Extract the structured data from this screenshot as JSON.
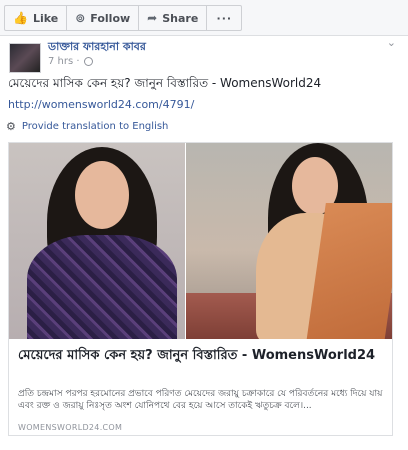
{
  "toolbar": {
    "like_label": "Like",
    "follow_label": "Follow",
    "share_label": "Share",
    "more_label": "···"
  },
  "post": {
    "author": "ডাক্তার ফারহানা কাবর",
    "time": "7 hrs",
    "privacy_icon": "globe-icon",
    "text": "মেয়েদের মাসিক কেন হয়? জানুন বিস্তারিত - WomensWorld24",
    "link": "http://womensworld24.com/4791/",
    "translate_label": "Provide translation to English"
  },
  "card": {
    "title": "মেয়েদের মাসিক কেন হয়? জানুন বিস্তারিত - WomensWorld24",
    "description": "প্রতি চন্দ্রমাস পরপর হরমোনের প্রভাবে পরিণত মেয়েদের জরায়ু চক্রাকারে যে পরিবর্তনের মধ্যে দিয়ে যায় এবং রক্ত ও জরায়ু নিঃসৃত অংশ যোনিপথে বের হয়ে আসে তাকেই ঋতুচক্র বলে।...",
    "domain": "WOMENSWORLD24.COM"
  },
  "colors": {
    "link": "#365899",
    "background": "#e9ebee",
    "text": "#1d2129"
  }
}
